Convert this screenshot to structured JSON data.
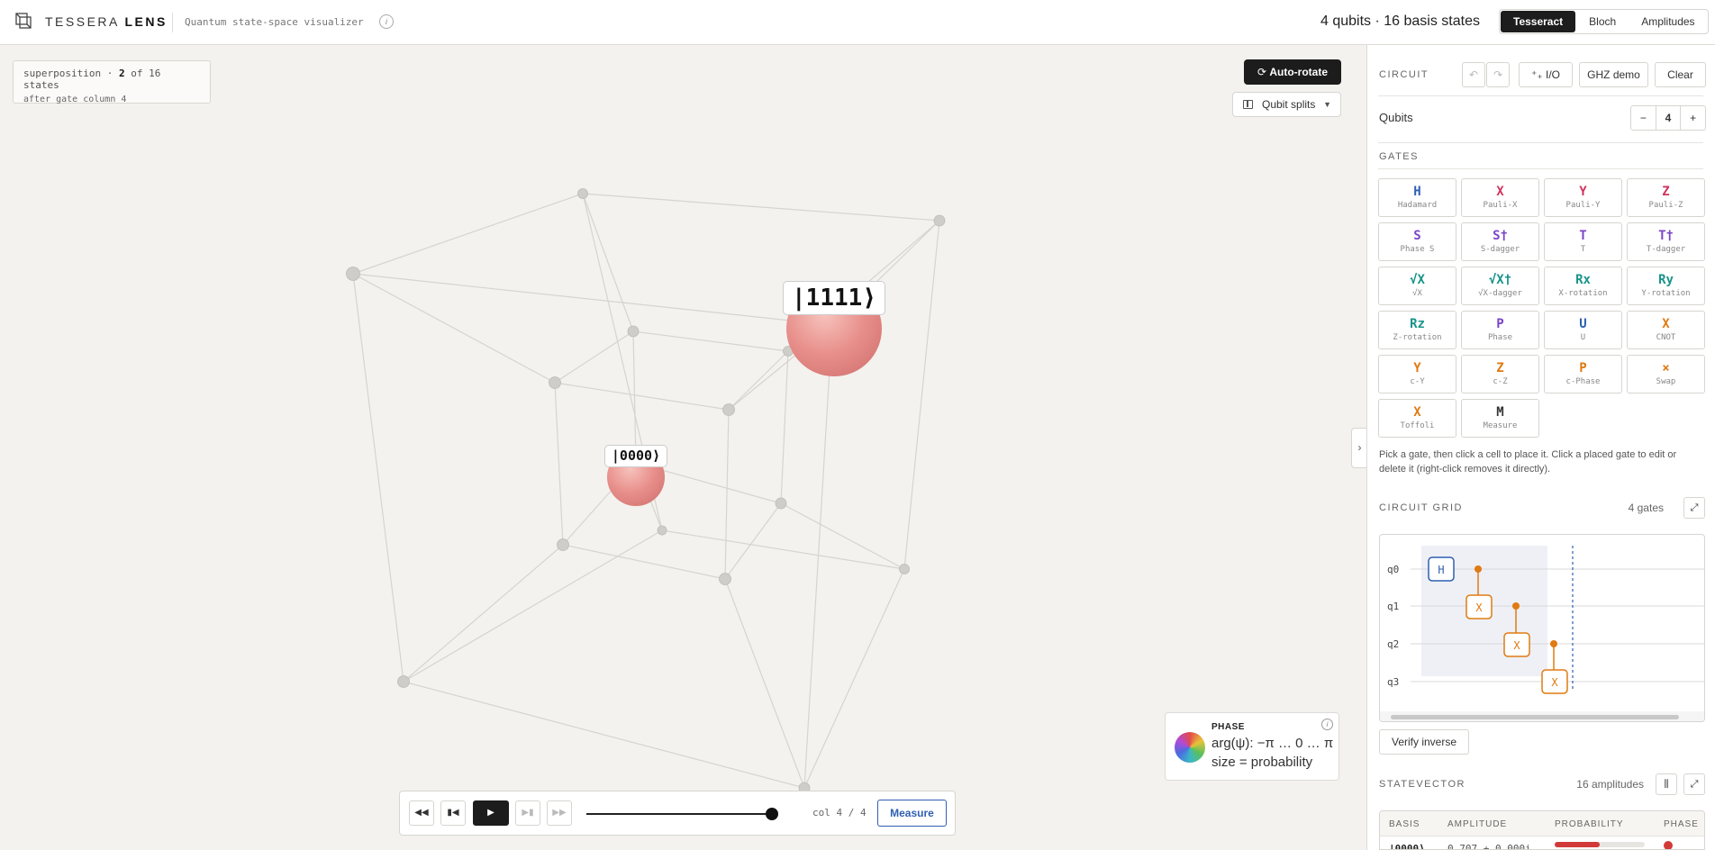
{
  "app": {
    "name_light": "TESSERA",
    "name_bold": "LENS",
    "subtitle": "Quantum state-space visualizer",
    "info": "i"
  },
  "header": {
    "summary": "4 qubits · 16 basis states",
    "tabs": [
      {
        "label": "Tesseract",
        "active": true
      },
      {
        "label": "Bloch",
        "active": false
      },
      {
        "label": "Amplitudes",
        "active": false
      }
    ]
  },
  "stage": {
    "badge": {
      "prefix": "superposition · ",
      "count": "2",
      "suffix": " of 16 states",
      "detail": "after gate column 4"
    },
    "autorotate_label": "Auto-rotate",
    "splits_label": "Qubit splits",
    "kets": {
      "k1111": "|1111⟩",
      "k0000": "|0000⟩"
    },
    "legend": {
      "title": "PHASE",
      "line1": "arg(ψ): −π … 0 … π",
      "line2": "size = probability",
      "info": "i"
    },
    "playback": {
      "col_label": "col 4 / 4",
      "measure_label": "Measure",
      "position": 1.0
    }
  },
  "panel": {
    "circuit_label": "CIRCUIT",
    "io_label": "I/O",
    "ghz_label": "GHZ demo",
    "clear_label": "Clear",
    "qubits_label": "Qubits",
    "qubits_value": "4",
    "minus": "−",
    "plus": "+",
    "gates_label": "GATES",
    "gates": [
      {
        "sym": "H",
        "name": "Hadamard",
        "color": "#2f5fb3"
      },
      {
        "sym": "X",
        "name": "Pauli-X",
        "color": "#d0335c"
      },
      {
        "sym": "Y",
        "name": "Pauli-Y",
        "color": "#d0335c"
      },
      {
        "sym": "Z",
        "name": "Pauli-Z",
        "color": "#d0335c"
      },
      {
        "sym": "S",
        "name": "Phase S",
        "color": "#7b45c8"
      },
      {
        "sym": "S†",
        "name": "S-dagger",
        "color": "#7b45c8"
      },
      {
        "sym": "T",
        "name": "T",
        "color": "#7b45c8"
      },
      {
        "sym": "T†",
        "name": "T-dagger",
        "color": "#7b45c8"
      },
      {
        "sym": "√X",
        "name": "√X",
        "color": "#18948a"
      },
      {
        "sym": "√X†",
        "name": "√X-dagger",
        "color": "#18948a"
      },
      {
        "sym": "Rx",
        "name": "X-rotation",
        "color": "#18948a"
      },
      {
        "sym": "Ry",
        "name": "Y-rotation",
        "color": "#18948a"
      },
      {
        "sym": "Rz",
        "name": "Z-rotation",
        "color": "#18948a"
      },
      {
        "sym": "P",
        "name": "Phase",
        "color": "#7b45c8"
      },
      {
        "sym": "U",
        "name": "U",
        "color": "#2f5fb3"
      },
      {
        "sym": "X",
        "name": "CNOT",
        "color": "#e07a12"
      },
      {
        "sym": "Y",
        "name": "c-Y",
        "color": "#e07a12"
      },
      {
        "sym": "Z",
        "name": "c-Z",
        "color": "#e07a12"
      },
      {
        "sym": "P",
        "name": "c-Phase",
        "color": "#e07a12"
      },
      {
        "sym": "×",
        "name": "Swap",
        "color": "#e07a12"
      },
      {
        "sym": "X",
        "name": "Toffoli",
        "color": "#e07a12"
      },
      {
        "sym": "M",
        "name": "Measure",
        "color": "#333333"
      }
    ],
    "hint": "Pick a gate, then click a cell to place it. Click a placed gate to edit or delete it (right-click removes it directly).",
    "grid_label": "CIRCUIT GRID",
    "grid_count": "4 gates",
    "qubit_labels": [
      "q0",
      "q1",
      "q2",
      "q3"
    ],
    "grid_gates": {
      "h": "H",
      "x1": "X",
      "x2": "X",
      "x3": "X"
    },
    "verify_label": "Verify inverse",
    "statevector_label": "STATEVECTOR",
    "statevector_count": "16 amplitudes",
    "table_headers": [
      "BASIS",
      "AMPLITUDE",
      "PROBABILITY",
      "PHASE"
    ],
    "row0": {
      "basis": "|0000⟩",
      "amplitude": "0.707 + 0.000i",
      "probability": 0.5
    }
  },
  "colors": {
    "accent": "#2f5fb3",
    "control": "#e07a12",
    "sphere": "#e88f8b"
  }
}
